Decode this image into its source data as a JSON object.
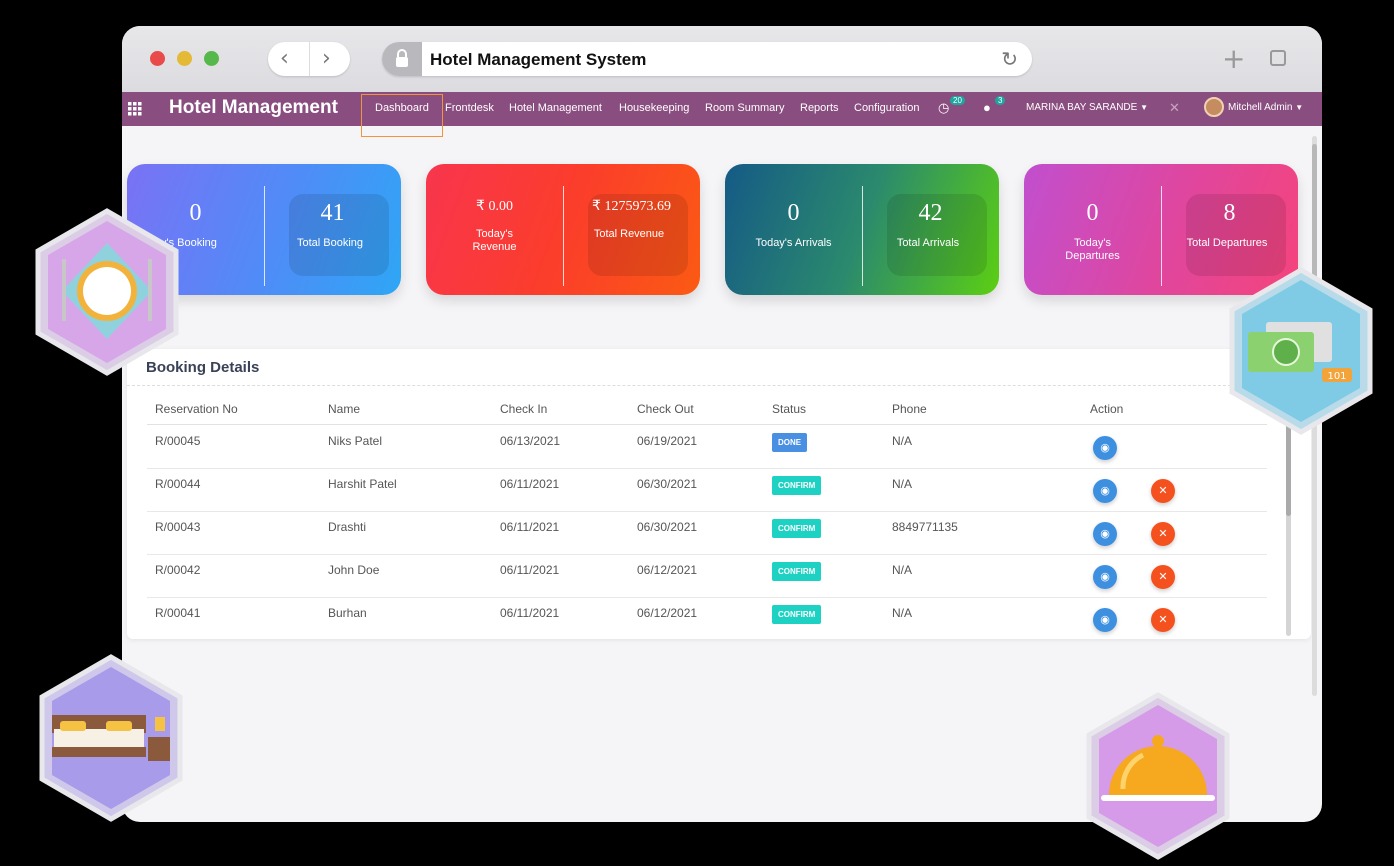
{
  "browser": {
    "url_title": "Hotel Management System",
    "traffic_colors": [
      "#e94b4b",
      "#e3b935",
      "#56b84a"
    ]
  },
  "navbar": {
    "brand": "Hotel Management",
    "menu": [
      "Dashboard",
      "Frontdesk",
      "Hotel Management",
      "Housekeeping",
      "Room Summary",
      "Reports",
      "Configuration"
    ],
    "activity_count": "20",
    "message_count": "3",
    "company": "MARINA BAY SARANDE",
    "user": "Mitchell Admin",
    "bg_color": "#8a4d7f"
  },
  "cards": [
    {
      "left_value": "0",
      "left_label": "Today's Booking",
      "right_value": "41",
      "right_label": "Total Booking"
    },
    {
      "left_value": "₹ 0.00",
      "left_label": "Today's Revenue",
      "right_value": "₹ 1275973.69",
      "right_label": "Total Revenue"
    },
    {
      "left_value": "0",
      "left_label": "Today's Arrivals",
      "right_value": "42",
      "right_label": "Total Arrivals"
    },
    {
      "left_value": "0",
      "left_label": "Today's Departures",
      "right_value": "8",
      "right_label": "Total Departures"
    }
  ],
  "booking": {
    "title": "Booking Details",
    "columns": [
      "Reservation No",
      "Name",
      "Check In",
      "Check Out",
      "Status",
      "Phone",
      "Action"
    ],
    "rows": [
      {
        "res": "R/00045",
        "name": "Niks Patel",
        "in": "06/13/2021",
        "out": "06/19/2021",
        "status": "DONE",
        "phone": "N/A"
      },
      {
        "res": "R/00044",
        "name": "Harshit Patel",
        "in": "06/11/2021",
        "out": "06/30/2021",
        "status": "CONFIRM",
        "phone": "N/A"
      },
      {
        "res": "R/00043",
        "name": "Drashti",
        "in": "06/11/2021",
        "out": "06/30/2021",
        "status": "CONFIRM",
        "phone": "8849771135"
      },
      {
        "res": "R/00042",
        "name": "John Doe",
        "in": "06/11/2021",
        "out": "06/12/2021",
        "status": "CONFIRM",
        "phone": "N/A"
      },
      {
        "res": "R/00041",
        "name": "Burhan",
        "in": "06/11/2021",
        "out": "06/12/2021",
        "status": "CONFIRM",
        "phone": "N/A"
      }
    ],
    "status_colors": {
      "DONE": "#4a90e2",
      "CONFIRM": "#1ed2c3"
    }
  },
  "decor": {
    "room_tag": "101"
  }
}
